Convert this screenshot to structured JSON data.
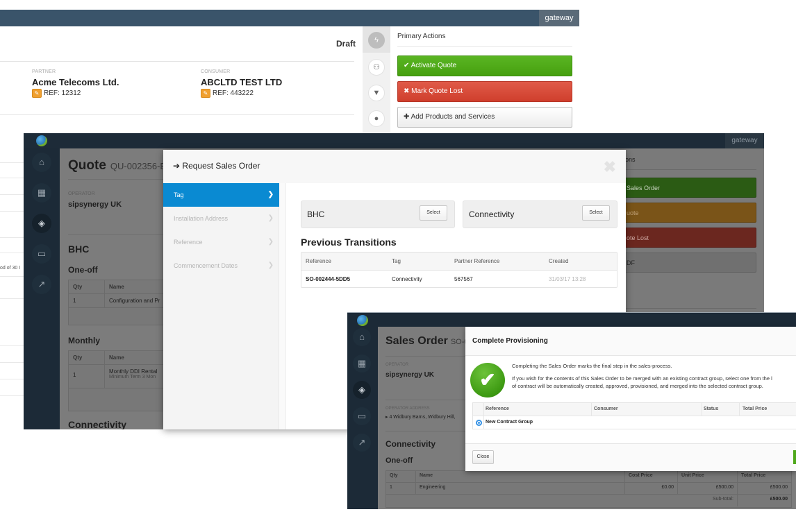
{
  "screen1": {
    "brand": "gateway",
    "status": "Draft",
    "partner": {
      "label": "PARTNER",
      "name": "Acme Telecoms Ltd.",
      "ref": "REF: 12312"
    },
    "consumer": {
      "label": "CONSUMER",
      "name": "ABCLTD TEST LTD",
      "ref": "REF: 443222"
    },
    "rail_icons": [
      "lightning-icon",
      "sitemap-icon",
      "filter-icon",
      "chat-icon"
    ],
    "primary_actions": {
      "title": "Primary Actions",
      "buttons": [
        {
          "label": "Activate Quote",
          "icon": "✔",
          "color": "#52ad1c"
        },
        {
          "label": "Mark Quote Lost",
          "icon": "✖",
          "color": "#d94c3a"
        },
        {
          "label": "Add Products and Services",
          "icon": "✚",
          "color": "#f4f4f4"
        }
      ]
    }
  },
  "screen2": {
    "brand": "gateway",
    "title": "Quote",
    "ref": "QU-002356-B4",
    "operator": {
      "label": "OPERATOR",
      "name": "sipsynergy UK"
    },
    "left_strip_text": "od of 30 I",
    "section": "BHC",
    "one_off": {
      "title": "One-off",
      "headers": [
        "Qty",
        "Name"
      ],
      "rows": [
        [
          "1",
          "Configuration and Pr"
        ]
      ]
    },
    "monthly": {
      "title": "Monthly",
      "headers": [
        "Qty",
        "Name"
      ],
      "rows": [
        [
          "1",
          "Monthly DDI Rental",
          "Minimum Term 3 Mon"
        ]
      ]
    },
    "section2": "Connectivity",
    "primary_actions": {
      "title": "ons",
      "buttons": [
        "Sales Order",
        "uote",
        "ote Lost",
        "DF"
      ]
    }
  },
  "request_modal": {
    "title": "Request Sales Order",
    "title_icon": "➔",
    "close_icon": "✖",
    "steps": [
      {
        "label": "Tag",
        "selected": true
      },
      {
        "label": "Installation Address",
        "selected": false
      },
      {
        "label": "Reference",
        "selected": false
      },
      {
        "label": "Commencement Dates",
        "selected": false
      }
    ],
    "tags": [
      {
        "name": "BHC",
        "button": "Select"
      },
      {
        "name": "Connectivity",
        "button": "Select"
      }
    ],
    "previous_transitions": {
      "title": "Previous Transitions",
      "headers": [
        "Reference",
        "Tag",
        "Partner Reference",
        "Created"
      ],
      "rows": [
        [
          "SO-002444-5DD5",
          "Connectivity",
          "567567",
          "31/03/17 13:28"
        ]
      ]
    }
  },
  "screen3": {
    "title": "Sales Order",
    "ref": "SO-00",
    "operator": {
      "label": "OPERATOR",
      "name": "sipsynergy UK"
    },
    "address": {
      "label": "OPERATOR ADDRESS",
      "value": "▸ 4 Widbury Barns, Widbury Hill,"
    },
    "section": "Connectivity",
    "one_off": {
      "title": "One-off",
      "headers": [
        "Qty",
        "Name",
        "Cost Price",
        "Unit Price",
        "Total Price"
      ],
      "rows": [
        [
          "1",
          "Engineering",
          "£0.00",
          "£500.00",
          "£500.00"
        ]
      ],
      "subtotal_label": "Sub-total:",
      "subtotal": "£500.00"
    }
  },
  "provision_modal": {
    "title": "Complete Provisioning",
    "line1": "Completing the Sales Order marks the final step in the sales-process.",
    "line2": "If you wish for the contents of this Sales Order to be merged with an existing contract group, select one from the l",
    "line3": "of contract will be automatically created, approved, provisioned, and merged into the selected contract group.",
    "headers": [
      "Reference",
      "Consumer",
      "Status",
      "Total Price"
    ],
    "rows": [
      [
        "New Contract Group",
        "",
        "",
        ""
      ]
    ],
    "close_label": "Close"
  }
}
